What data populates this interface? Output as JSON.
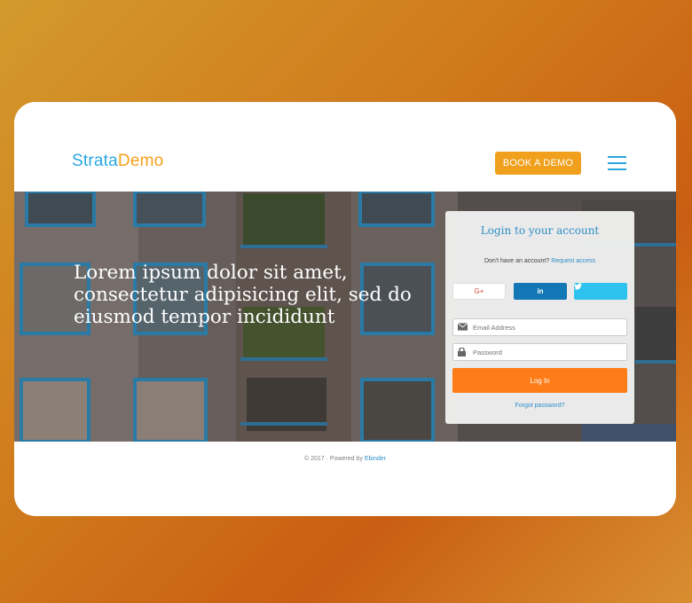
{
  "brand": {
    "part1": "Strata",
    "part2": "Demo"
  },
  "header": {
    "demo_button": "BOOK A DEMO",
    "menu_icon": "hamburger-icon"
  },
  "hero": {
    "headline": "Lorem ipsum dolor sit amet, consectetur adipisicing elit, sed do eiusmod tempor incididunt"
  },
  "login": {
    "title": "Login to your account",
    "no_account_text": "Don't have an account?",
    "request_access": "Request access",
    "social": {
      "google": "G+",
      "linkedin": "in",
      "twitter": "twitter-icon"
    },
    "email_placeholder": "Email Address",
    "password_placeholder": "Password",
    "login_button": "Log In",
    "forgot_password": "Forgot password?"
  },
  "footer": {
    "text": "© 2017 · Powered by",
    "link": "Ebinder"
  },
  "colors": {
    "brand_blue": "#29a8e0",
    "brand_orange": "#f4a11b",
    "cta": "#fe7d19"
  }
}
